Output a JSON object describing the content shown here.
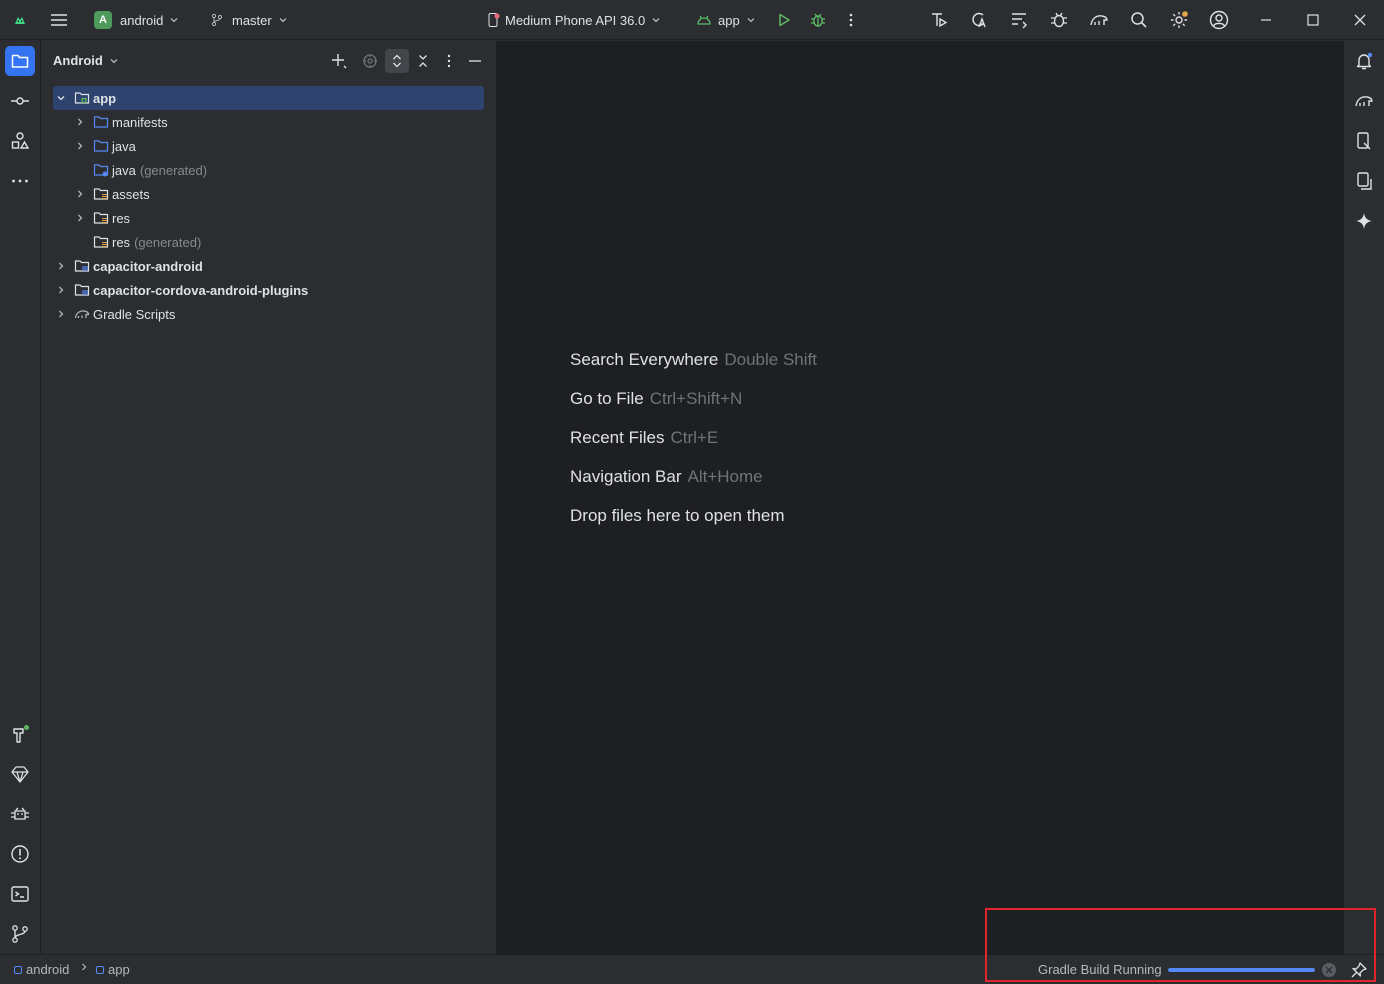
{
  "titlebar": {
    "project_badge": "A",
    "project_name": "android",
    "branch": "master",
    "device": "Medium Phone API 36.0",
    "run_config": "app"
  },
  "panel": {
    "title": "Android",
    "tree": [
      {
        "label": "app",
        "hint": ""
      },
      {
        "label": "manifests",
        "hint": ""
      },
      {
        "label": "java",
        "hint": ""
      },
      {
        "label": "java",
        "hint": "(generated)"
      },
      {
        "label": "assets",
        "hint": ""
      },
      {
        "label": "res",
        "hint": ""
      },
      {
        "label": "res",
        "hint": "(generated)"
      },
      {
        "label": "capacitor-android",
        "hint": ""
      },
      {
        "label": "capacitor-cordova-android-plugins",
        "hint": ""
      },
      {
        "label": "Gradle Scripts",
        "hint": ""
      }
    ]
  },
  "editor": {
    "hints": [
      {
        "action": "Search Everywhere",
        "key": "Double Shift"
      },
      {
        "action": "Go to File",
        "key": "Ctrl+Shift+N"
      },
      {
        "action": "Recent Files",
        "key": "Ctrl+E"
      },
      {
        "action": "Navigation Bar",
        "key": "Alt+Home"
      },
      {
        "action": "Drop files here to open them",
        "key": ""
      }
    ]
  },
  "statusbar": {
    "breadcrumb": [
      "android",
      "app"
    ],
    "build_label": "Gradle Build Running",
    "build_progress": 1.0
  },
  "colors": {
    "accent": "#3574f0",
    "selection": "#2e436e",
    "run_green": "#5fb865",
    "highlight": "#e0262b"
  }
}
